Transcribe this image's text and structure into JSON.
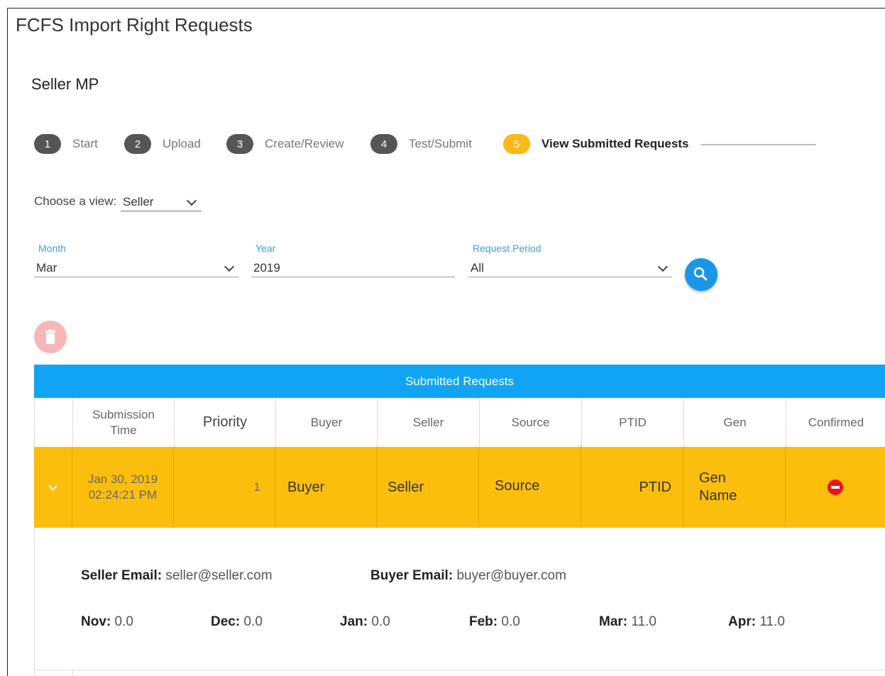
{
  "page_title": "FCFS Import Right Requests",
  "section_title": "Seller MP",
  "steps": [
    {
      "num": "1",
      "label": "Start"
    },
    {
      "num": "2",
      "label": "Upload"
    },
    {
      "num": "3",
      "label": "Create/Review"
    },
    {
      "num": "4",
      "label": "Test/Submit"
    },
    {
      "num": "5",
      "label": "View Submitted Requests"
    }
  ],
  "view": {
    "label": "Choose a view:",
    "value": "Seller"
  },
  "filters": {
    "month": {
      "label": "Month",
      "value": "Mar"
    },
    "year": {
      "label": "Year",
      "value": "2019"
    },
    "period": {
      "label": "Request Period",
      "value": "All"
    }
  },
  "table": {
    "title": "Submitted Requests",
    "columns": [
      "Submission Time",
      "Priority",
      "Buyer",
      "Seller",
      "Source",
      "PTID",
      "Gen",
      "Confirmed"
    ],
    "row": {
      "time_date": "Jan 30, 2019",
      "time_clock": "02:24:21 PM",
      "priority": "1",
      "buyer": "Buyer",
      "seller": "Seller",
      "source": "Source",
      "ptid": "PTID",
      "gen": "Gen Name"
    },
    "detail": {
      "seller_email_label": "Seller Email:",
      "seller_email": "seller@seller.com",
      "buyer_email_label": "Buyer Email:",
      "buyer_email": "buyer@buyer.com",
      "months": [
        {
          "label": "Nov:",
          "value": "0.0"
        },
        {
          "label": "Dec:",
          "value": "0.0"
        },
        {
          "label": "Jan:",
          "value": "0.0"
        },
        {
          "label": "Feb:",
          "value": "0.0"
        },
        {
          "label": "Mar:",
          "value": "11.0"
        },
        {
          "label": "Apr:",
          "value": "11.0"
        }
      ]
    }
  },
  "colors": {
    "accent": "#11a4f4",
    "active_step": "#fbb917",
    "row_highlight": "#fcbe0d",
    "confirm_no": "#e8141b"
  },
  "icons": [
    "search-icon",
    "trash-icon",
    "chevron-down-icon",
    "minus-circle-icon"
  ]
}
